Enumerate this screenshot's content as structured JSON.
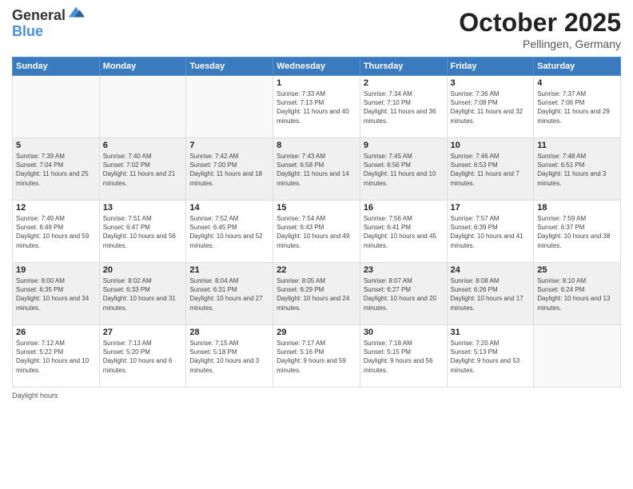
{
  "header": {
    "logo_general": "General",
    "logo_blue": "Blue",
    "month": "October 2025",
    "location": "Pellingen, Germany"
  },
  "days_of_week": [
    "Sunday",
    "Monday",
    "Tuesday",
    "Wednesday",
    "Thursday",
    "Friday",
    "Saturday"
  ],
  "weeks": [
    [
      {
        "day": "",
        "sunrise": "",
        "sunset": "",
        "daylight": ""
      },
      {
        "day": "",
        "sunrise": "",
        "sunset": "",
        "daylight": ""
      },
      {
        "day": "",
        "sunrise": "",
        "sunset": "",
        "daylight": ""
      },
      {
        "day": "1",
        "sunrise": "Sunrise: 7:33 AM",
        "sunset": "Sunset: 7:13 PM",
        "daylight": "Daylight: 11 hours and 40 minutes."
      },
      {
        "day": "2",
        "sunrise": "Sunrise: 7:34 AM",
        "sunset": "Sunset: 7:10 PM",
        "daylight": "Daylight: 11 hours and 36 minutes."
      },
      {
        "day": "3",
        "sunrise": "Sunrise: 7:36 AM",
        "sunset": "Sunset: 7:08 PM",
        "daylight": "Daylight: 11 hours and 32 minutes."
      },
      {
        "day": "4",
        "sunrise": "Sunrise: 7:37 AM",
        "sunset": "Sunset: 7:06 PM",
        "daylight": "Daylight: 11 hours and 29 minutes."
      }
    ],
    [
      {
        "day": "5",
        "sunrise": "Sunrise: 7:39 AM",
        "sunset": "Sunset: 7:04 PM",
        "daylight": "Daylight: 11 hours and 25 minutes."
      },
      {
        "day": "6",
        "sunrise": "Sunrise: 7:40 AM",
        "sunset": "Sunset: 7:02 PM",
        "daylight": "Daylight: 11 hours and 21 minutes."
      },
      {
        "day": "7",
        "sunrise": "Sunrise: 7:42 AM",
        "sunset": "Sunset: 7:00 PM",
        "daylight": "Daylight: 11 hours and 18 minutes."
      },
      {
        "day": "8",
        "sunrise": "Sunrise: 7:43 AM",
        "sunset": "Sunset: 6:58 PM",
        "daylight": "Daylight: 11 hours and 14 minutes."
      },
      {
        "day": "9",
        "sunrise": "Sunrise: 7:45 AM",
        "sunset": "Sunset: 6:56 PM",
        "daylight": "Daylight: 11 hours and 10 minutes."
      },
      {
        "day": "10",
        "sunrise": "Sunrise: 7:46 AM",
        "sunset": "Sunset: 6:53 PM",
        "daylight": "Daylight: 11 hours and 7 minutes."
      },
      {
        "day": "11",
        "sunrise": "Sunrise: 7:48 AM",
        "sunset": "Sunset: 6:51 PM",
        "daylight": "Daylight: 11 hours and 3 minutes."
      }
    ],
    [
      {
        "day": "12",
        "sunrise": "Sunrise: 7:49 AM",
        "sunset": "Sunset: 6:49 PM",
        "daylight": "Daylight: 10 hours and 59 minutes."
      },
      {
        "day": "13",
        "sunrise": "Sunrise: 7:51 AM",
        "sunset": "Sunset: 6:47 PM",
        "daylight": "Daylight: 10 hours and 56 minutes."
      },
      {
        "day": "14",
        "sunrise": "Sunrise: 7:52 AM",
        "sunset": "Sunset: 6:45 PM",
        "daylight": "Daylight: 10 hours and 52 minutes."
      },
      {
        "day": "15",
        "sunrise": "Sunrise: 7:54 AM",
        "sunset": "Sunset: 6:43 PM",
        "daylight": "Daylight: 10 hours and 49 minutes."
      },
      {
        "day": "16",
        "sunrise": "Sunrise: 7:56 AM",
        "sunset": "Sunset: 6:41 PM",
        "daylight": "Daylight: 10 hours and 45 minutes."
      },
      {
        "day": "17",
        "sunrise": "Sunrise: 7:57 AM",
        "sunset": "Sunset: 6:39 PM",
        "daylight": "Daylight: 10 hours and 41 minutes."
      },
      {
        "day": "18",
        "sunrise": "Sunrise: 7:59 AM",
        "sunset": "Sunset: 6:37 PM",
        "daylight": "Daylight: 10 hours and 38 minutes."
      }
    ],
    [
      {
        "day": "19",
        "sunrise": "Sunrise: 8:00 AM",
        "sunset": "Sunset: 6:35 PM",
        "daylight": "Daylight: 10 hours and 34 minutes."
      },
      {
        "day": "20",
        "sunrise": "Sunrise: 8:02 AM",
        "sunset": "Sunset: 6:33 PM",
        "daylight": "Daylight: 10 hours and 31 minutes."
      },
      {
        "day": "21",
        "sunrise": "Sunrise: 8:04 AM",
        "sunset": "Sunset: 6:31 PM",
        "daylight": "Daylight: 10 hours and 27 minutes."
      },
      {
        "day": "22",
        "sunrise": "Sunrise: 8:05 AM",
        "sunset": "Sunset: 6:29 PM",
        "daylight": "Daylight: 10 hours and 24 minutes."
      },
      {
        "day": "23",
        "sunrise": "Sunrise: 8:07 AM",
        "sunset": "Sunset: 6:27 PM",
        "daylight": "Daylight: 10 hours and 20 minutes."
      },
      {
        "day": "24",
        "sunrise": "Sunrise: 8:08 AM",
        "sunset": "Sunset: 6:26 PM",
        "daylight": "Daylight: 10 hours and 17 minutes."
      },
      {
        "day": "25",
        "sunrise": "Sunrise: 8:10 AM",
        "sunset": "Sunset: 6:24 PM",
        "daylight": "Daylight: 10 hours and 13 minutes."
      }
    ],
    [
      {
        "day": "26",
        "sunrise": "Sunrise: 7:12 AM",
        "sunset": "Sunset: 5:22 PM",
        "daylight": "Daylight: 10 hours and 10 minutes."
      },
      {
        "day": "27",
        "sunrise": "Sunrise: 7:13 AM",
        "sunset": "Sunset: 5:20 PM",
        "daylight": "Daylight: 10 hours and 6 minutes."
      },
      {
        "day": "28",
        "sunrise": "Sunrise: 7:15 AM",
        "sunset": "Sunset: 5:18 PM",
        "daylight": "Daylight: 10 hours and 3 minutes."
      },
      {
        "day": "29",
        "sunrise": "Sunrise: 7:17 AM",
        "sunset": "Sunset: 5:16 PM",
        "daylight": "Daylight: 9 hours and 59 minutes."
      },
      {
        "day": "30",
        "sunrise": "Sunrise: 7:18 AM",
        "sunset": "Sunset: 5:15 PM",
        "daylight": "Daylight: 9 hours and 56 minutes."
      },
      {
        "day": "31",
        "sunrise": "Sunrise: 7:20 AM",
        "sunset": "Sunset: 5:13 PM",
        "daylight": "Daylight: 9 hours and 53 minutes."
      },
      {
        "day": "",
        "sunrise": "",
        "sunset": "",
        "daylight": ""
      }
    ]
  ],
  "footer": {
    "daylight_label": "Daylight hours"
  }
}
